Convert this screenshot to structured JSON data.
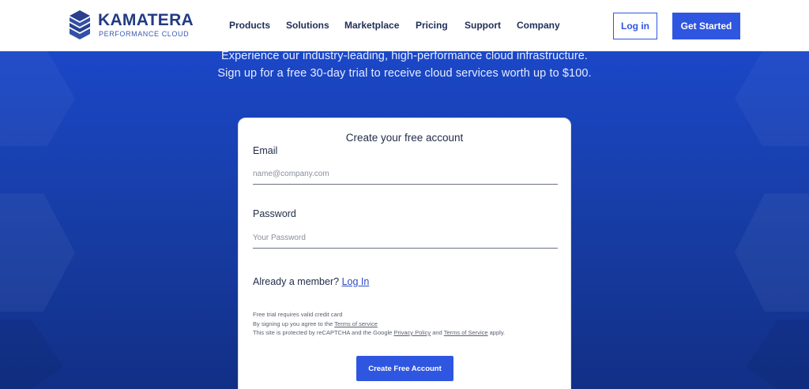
{
  "brand": {
    "name": "KAMATERA",
    "tagline": "PERFORMANCE CLOUD",
    "logo_icon": "stacked-hexagon-logo-icon",
    "primary_color": "#2f56e0",
    "hero_color": "#1b47c8"
  },
  "nav": {
    "items": [
      {
        "label": "Products"
      },
      {
        "label": "Solutions"
      },
      {
        "label": "Marketplace"
      },
      {
        "label": "Pricing"
      },
      {
        "label": "Support"
      },
      {
        "label": "Company"
      }
    ],
    "login_label": "Log in",
    "get_started_label": "Get Started"
  },
  "hero": {
    "line1": "Experience our industry-leading, high-performance cloud infrastructure.",
    "line2": "Sign up for a free 30-day trial to receive cloud services worth up to $100."
  },
  "form": {
    "title": "Create your free account",
    "email_label": "Email",
    "email_placeholder": "name@company.com",
    "password_label": "Password",
    "password_placeholder": "Your Password",
    "member_text": "Already a member?",
    "member_link": "Log In",
    "fine1": "Free trial requires valid credit card",
    "fine2_prefix": "By signing up you agree to the",
    "fine2_link": "Terms of service",
    "fine3_prefix": "This site is protected by reCAPTCHA and the Google",
    "fine3_link1": "Privacy Policy",
    "fine3_and": "and",
    "fine3_link2": "Terms of Service",
    "fine3_suffix": "apply.",
    "submit_label": "Create Free Account"
  }
}
